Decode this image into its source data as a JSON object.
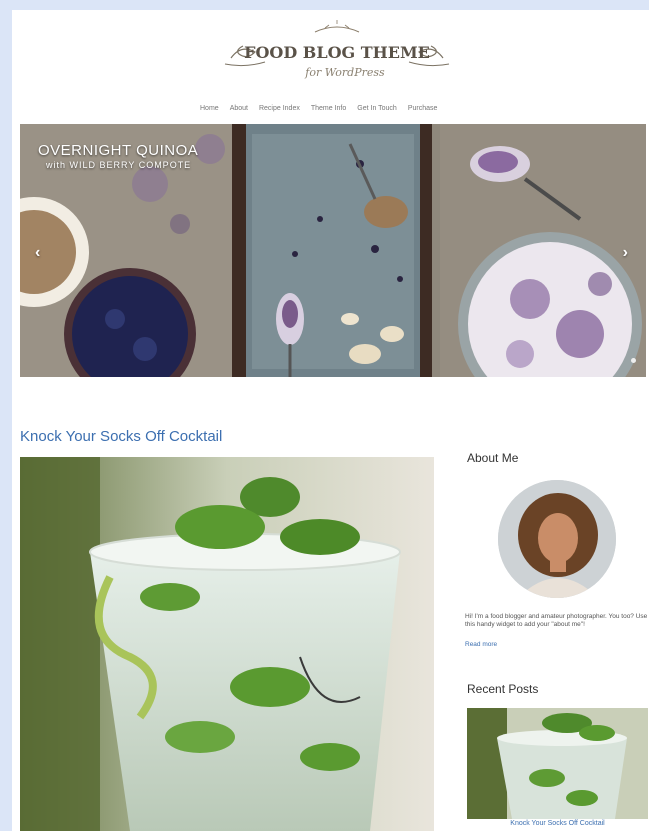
{
  "header": {
    "logo_title": "FOOD BLOG THEME",
    "logo_subtitle": "for WordPress"
  },
  "nav": {
    "items": [
      "Home",
      "About",
      "Recipe Index",
      "Theme Info",
      "Get In Touch",
      "Purchase"
    ]
  },
  "slider": {
    "title": "OVERNIGHT QUINOA",
    "subtitle": "with WILD BERRY COMPOTE",
    "prev_arrow": "‹",
    "next_arrow": "›"
  },
  "post": {
    "title": "Knock Your Socks Off Cocktail"
  },
  "sidebar": {
    "about_heading": "About Me",
    "about_text": "Hi! I'm a food blogger and amateur photographer. You too? Use this handy widget to add your \"about me\"!",
    "read_more": "Read more",
    "recent_heading": "Recent Posts",
    "recent_caption": "Knock Your Socks Off Cocktail"
  },
  "colors": {
    "link": "#3c6fb0",
    "background": "#dbe5f7"
  }
}
